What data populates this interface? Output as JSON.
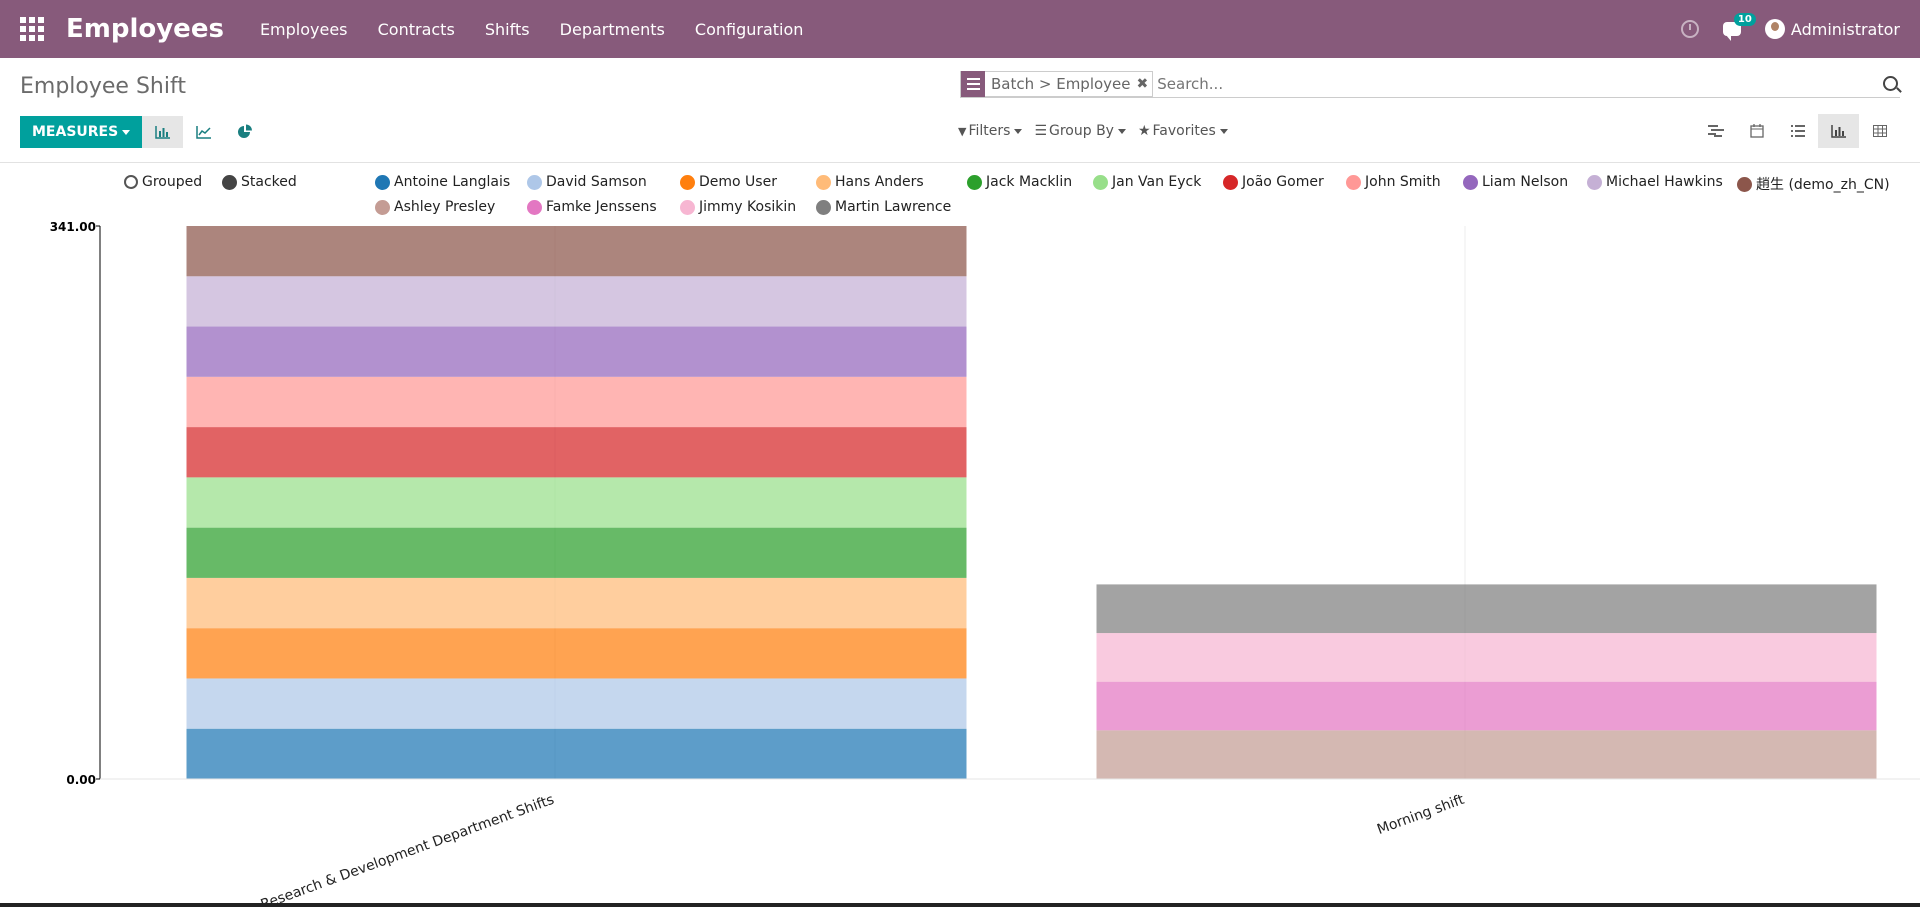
{
  "navbar": {
    "app_title": "Employees",
    "menu": [
      "Employees",
      "Contracts",
      "Shifts",
      "Departments",
      "Configuration"
    ],
    "notification_count": "10",
    "user": "Administrator",
    "color": "#875a7b"
  },
  "page": {
    "title": "Employee Shift",
    "facet_label": "Batch > Employee",
    "search_placeholder": "Search...",
    "measures_label": "MEASURES",
    "filters_label": "Filters",
    "groupby_label": "Group By",
    "favorites_label": "Favorites",
    "accent": "#00a09d"
  },
  "legend_modes": [
    "Grouped",
    "Stacked"
  ],
  "chart_data": {
    "type": "bar",
    "mode": "stacked",
    "categories": [
      "Research & Development Department Shifts",
      "Morning shift"
    ],
    "ylim": [
      0,
      341
    ],
    "y_tick_labels": [
      "341.00",
      "0.00"
    ],
    "series": [
      {
        "name": "Antoine Langlais",
        "color": "#1f77b4",
        "values": [
          31,
          0
        ]
      },
      {
        "name": "David Samson",
        "color": "#aec7e8",
        "values": [
          31,
          0
        ]
      },
      {
        "name": "Demo User",
        "color": "#ff7f0e",
        "values": [
          31,
          0
        ]
      },
      {
        "name": "Hans Anders",
        "color": "#ffbb78",
        "values": [
          31,
          0
        ]
      },
      {
        "name": "Jack Macklin",
        "color": "#2ca02c",
        "values": [
          31,
          0
        ]
      },
      {
        "name": "Jan Van Eyck",
        "color": "#98df8a",
        "values": [
          31,
          0
        ]
      },
      {
        "name": "João Gomer",
        "color": "#d62728",
        "values": [
          31,
          0
        ]
      },
      {
        "name": "John Smith",
        "color": "#ff9896",
        "values": [
          31,
          0
        ]
      },
      {
        "name": "Liam Nelson",
        "color": "#9467bd",
        "values": [
          31,
          0
        ]
      },
      {
        "name": "Michael Hawkins",
        "color": "#c5b0d5",
        "values": [
          31,
          0
        ]
      },
      {
        "name": "趙生 (demo_zh_CN)",
        "color": "#8c564b",
        "values": [
          31,
          0
        ]
      },
      {
        "name": "Ashley Presley",
        "color": "#c49c94",
        "values": [
          0,
          30
        ]
      },
      {
        "name": "Famke Jenssens",
        "color": "#e377c2",
        "values": [
          0,
          30
        ]
      },
      {
        "name": "Jimmy Kosikin",
        "color": "#f7b6d2",
        "values": [
          0,
          30
        ]
      },
      {
        "name": "Martin Lawrence",
        "color": "#7f7f7f",
        "values": [
          0,
          30
        ]
      }
    ]
  }
}
